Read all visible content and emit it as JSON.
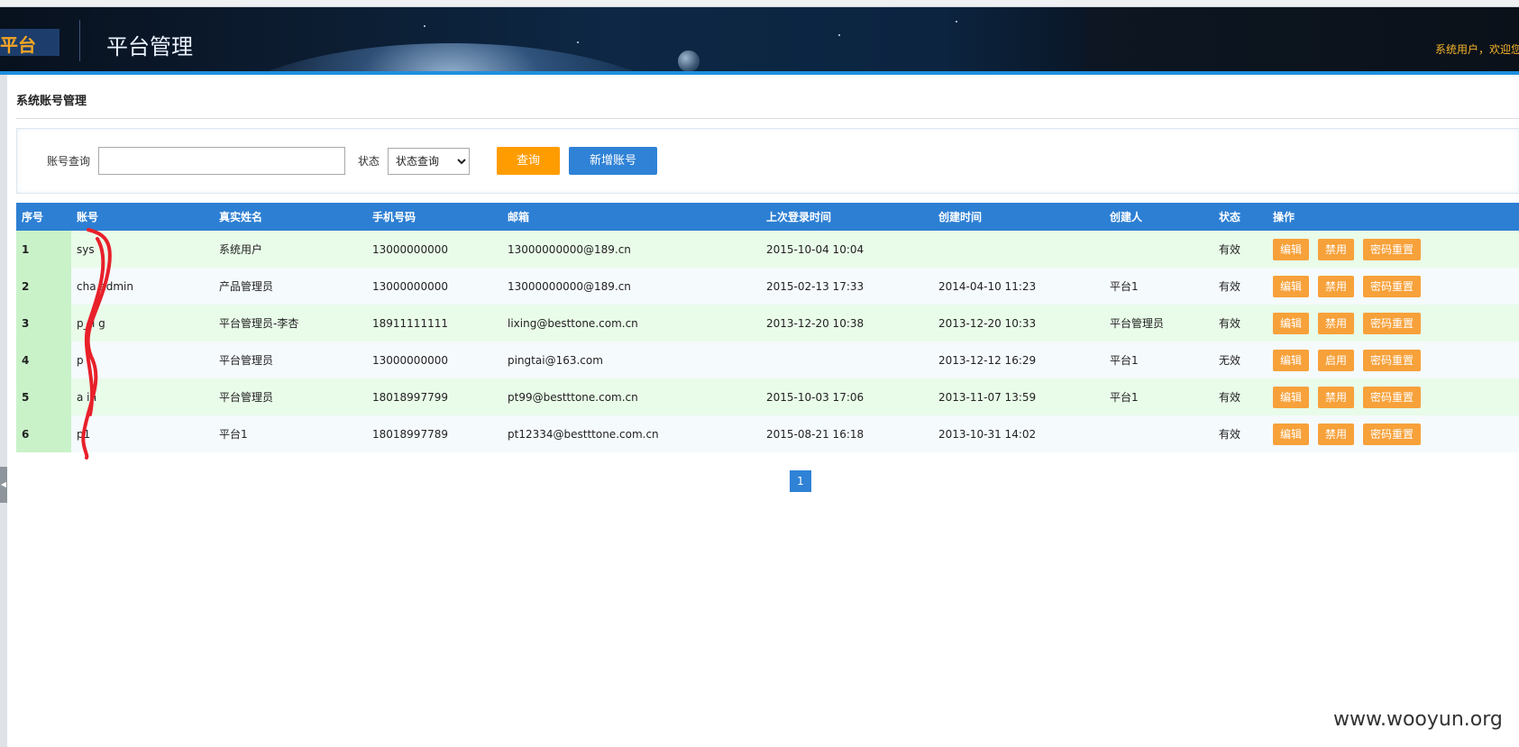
{
  "header": {
    "logo_text": "平台",
    "title": "平台管理",
    "welcome": "系统用户，欢迎您"
  },
  "page": {
    "title": "系统账号管理"
  },
  "search": {
    "account_label": "账号查询",
    "account_value": "",
    "status_label": "状态",
    "status_selected": "状态查询",
    "query_button": "查询",
    "add_button": "新增账号"
  },
  "table": {
    "columns": [
      "序号",
      "账号",
      "真实姓名",
      "手机号码",
      "邮箱",
      "上次登录时间",
      "创建时间",
      "创建人",
      "状态",
      "操作"
    ],
    "rows": [
      {
        "idx": "1",
        "account": "sys",
        "name": "系统用户",
        "phone": "13000000000",
        "email": "13000000000@189.cn",
        "last_login": "2015-10-04 10:04",
        "created": "",
        "creator": "",
        "status": "有效",
        "ops": [
          "编辑",
          "禁用",
          "密码重置"
        ]
      },
      {
        "idx": "2",
        "account": "cha admin",
        "name": "产品管理员",
        "phone": "13000000000",
        "email": "13000000000@189.cn",
        "last_login": "2015-02-13 17:33",
        "created": "2014-04-10 11:23",
        "creator": "平台1",
        "status": "有效",
        "ops": [
          "编辑",
          "禁用",
          "密码重置"
        ]
      },
      {
        "idx": "3",
        "account": "p_li g",
        "name": "平台管理员-李杏",
        "phone": "18911111111",
        "email": "lixing@besttone.com.cn",
        "last_login": "2013-12-20 10:38",
        "created": "2013-12-20 10:33",
        "creator": "平台管理员",
        "status": "有效",
        "ops": [
          "编辑",
          "禁用",
          "密码重置"
        ]
      },
      {
        "idx": "4",
        "account": "p i",
        "name": "平台管理员",
        "phone": "13000000000",
        "email": "pingtai@163.com",
        "last_login": "",
        "created": "2013-12-12 16:29",
        "creator": "平台1",
        "status": "无效",
        "ops": [
          "编辑",
          "启用",
          "密码重置"
        ]
      },
      {
        "idx": "5",
        "account": "a in",
        "name": "平台管理员",
        "phone": "18018997799",
        "email": "pt99@bestttone.com.cn",
        "last_login": "2015-10-03 17:06",
        "created": "2013-11-07 13:59",
        "creator": "平台1",
        "status": "有效",
        "ops": [
          "编辑",
          "禁用",
          "密码重置"
        ]
      },
      {
        "idx": "6",
        "account": "p1",
        "name": "平台1",
        "phone": "18018997789",
        "email": "pt12334@bestttone.com.cn",
        "last_login": "2015-08-21 16:18",
        "created": "2013-10-31 14:02",
        "creator": "",
        "status": "有效",
        "ops": [
          "编辑",
          "禁用",
          "密码重置"
        ]
      }
    ]
  },
  "pagination": {
    "current": "1"
  },
  "watermark": "www.wooyun.org",
  "colors": {
    "header_accent": "#1f8fdc",
    "table_header": "#2d7fd3",
    "query_button": "#ff9c00",
    "add_button": "#2f82d6",
    "op_button": "#f7a13a",
    "welcome_text": "#f5b42a"
  }
}
